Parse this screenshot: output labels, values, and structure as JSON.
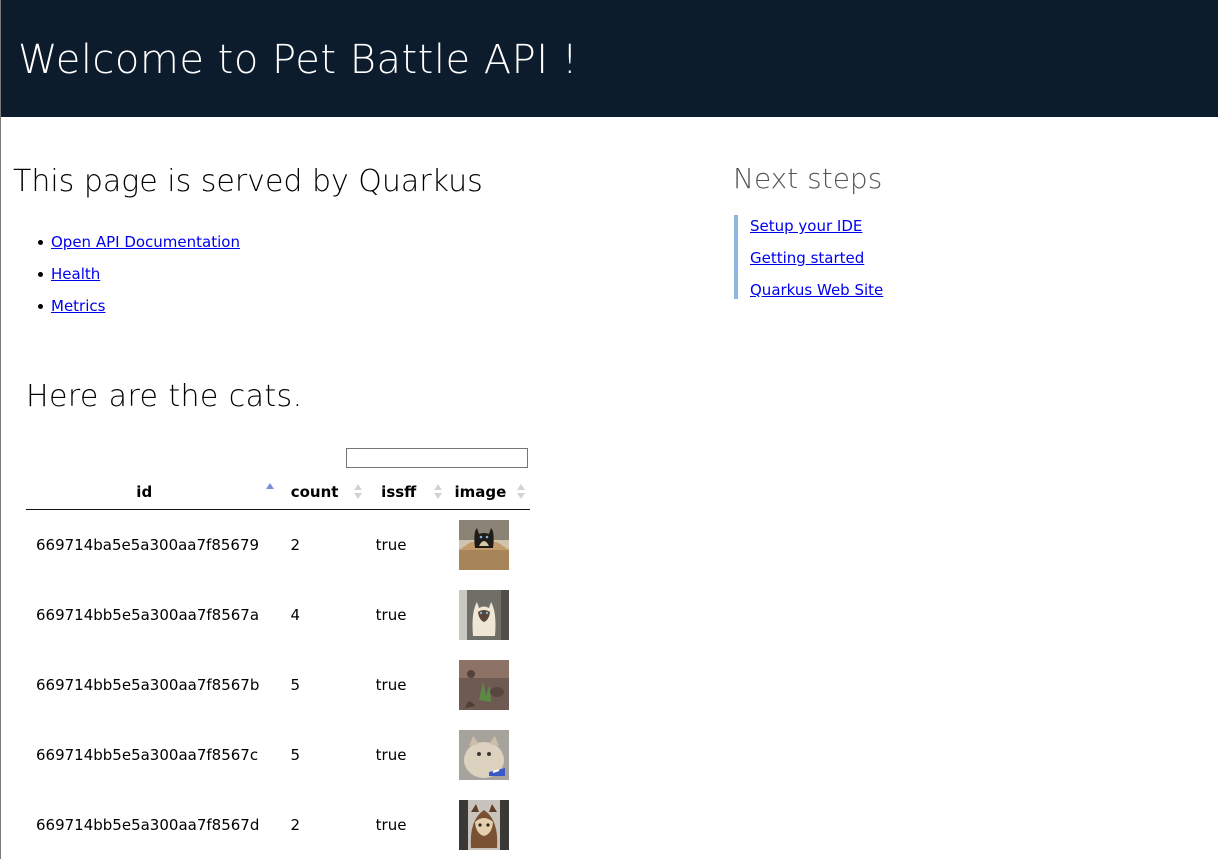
{
  "banner": {
    "title": "Welcome to Pet Battle API !"
  },
  "served": {
    "title": "This page is served by Quarkus",
    "links": [
      "Open API Documentation",
      "Health",
      "Metrics"
    ]
  },
  "next_steps": {
    "title": "Next steps",
    "links": [
      "Setup your IDE",
      "Getting started",
      "Quarkus Web Site"
    ]
  },
  "cats": {
    "title": "Here are the cats.",
    "search_value": "",
    "columns": [
      "id",
      "count",
      "issff",
      "image"
    ],
    "sorted_by": "id",
    "sort_direction": "ascending",
    "rows": [
      {
        "id": "669714ba5e5a300aa7f85679",
        "count": "2",
        "issff": "true",
        "image": "cat-in-box-photo"
      },
      {
        "id": "669714bb5e5a300aa7f8567a",
        "count": "4",
        "issff": "true",
        "image": "siamese-cat-photo"
      },
      {
        "id": "669714bb5e5a300aa7f8567b",
        "count": "5",
        "issff": "true",
        "image": "cat-on-grass-photo"
      },
      {
        "id": "669714bb5e5a300aa7f8567c",
        "count": "5",
        "issff": "true",
        "image": "fluffy-cat-photo"
      },
      {
        "id": "669714bb5e5a300aa7f8567d",
        "count": "2",
        "issff": "true",
        "image": "cat-in-costume-photo"
      }
    ]
  },
  "colors": {
    "banner_bg": "#0d1c2c",
    "link": "#0000ee",
    "next_steps_border": "#8eb6e3",
    "sort_active": "#7b8fd6"
  }
}
